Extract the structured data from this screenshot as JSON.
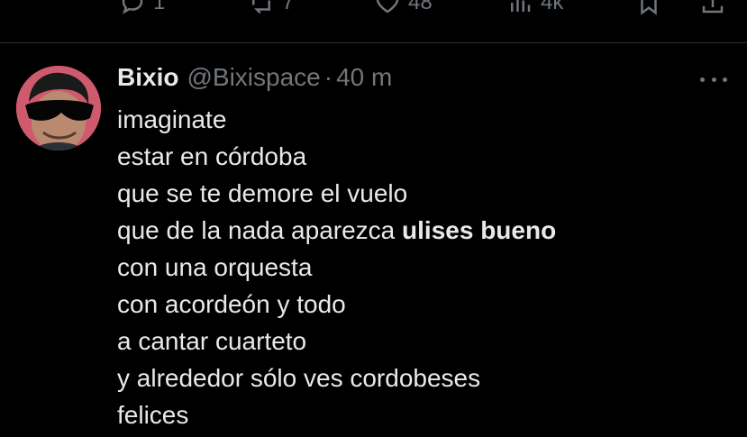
{
  "previous_tweet_actions": {
    "reply_count": "1",
    "repost_count": "7",
    "like_count": "48",
    "views_count": "4k"
  },
  "tweet": {
    "display_name": "Bixio",
    "handle": "@Bixispace",
    "separator": "·",
    "time": "40 m",
    "lines": [
      "imaginate",
      "estar en córdoba",
      "que se te demore el vuelo",
      "que de la nada aparezca ",
      "con una orquesta",
      "con acordeón y todo",
      "a cantar cuarteto",
      "y alrededor sólo ves cordobeses",
      "felices"
    ],
    "bold_text": "ulises bueno"
  },
  "icons": {
    "reply": "reply-icon",
    "repost": "repost-icon",
    "like": "heart-icon",
    "views": "views-icon",
    "bookmark": "bookmark-icon",
    "share": "share-icon",
    "more": "more-icon"
  },
  "colors": {
    "background": "#000000",
    "text": "#e7e9ea",
    "muted": "#71767b",
    "divider": "#2f3336",
    "avatar_bg": "#cf5a6e"
  }
}
